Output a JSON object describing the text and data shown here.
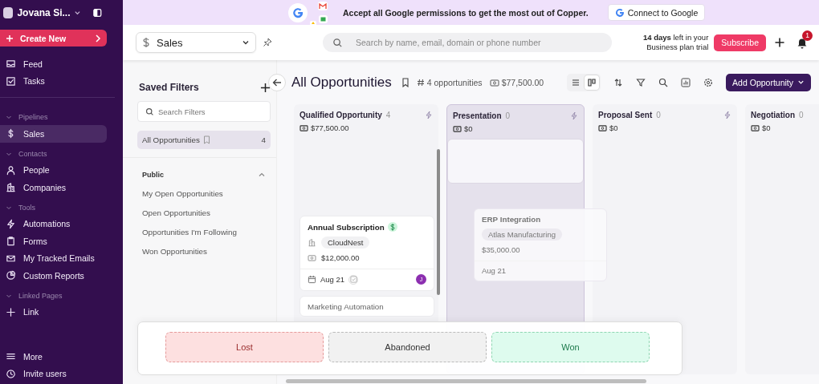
{
  "sidebar": {
    "workspace": "Jovana Si...",
    "create_button": "Create New",
    "groups": [
      {
        "items": [
          {
            "label": "Feed",
            "selected": false
          },
          {
            "label": "Tasks",
            "selected": false
          }
        ]
      },
      {
        "heading": "Pipelines",
        "items": [
          {
            "label": "Sales",
            "selected": true
          }
        ]
      },
      {
        "heading": "Contacts",
        "items": [
          {
            "label": "People",
            "selected": false
          },
          {
            "label": "Companies",
            "selected": false
          }
        ]
      },
      {
        "heading": "Tools",
        "items": [
          {
            "label": "Automations",
            "selected": false
          },
          {
            "label": "Forms",
            "selected": false
          },
          {
            "label": "My Tracked Emails",
            "selected": false
          },
          {
            "label": "Custom Reports",
            "selected": false
          }
        ]
      },
      {
        "heading": "Linked Pages",
        "items": [
          {
            "label": "Link",
            "selected": false
          }
        ]
      }
    ],
    "footer_items": [
      {
        "label": "More",
        "selected": false
      },
      {
        "label": "Invite users",
        "selected": false
      }
    ]
  },
  "banner": {
    "text": "Accept all Google permissions to get the most out of Copper.",
    "button": "Connect to Google"
  },
  "header": {
    "pipeline": "Sales",
    "search_placeholder": "Search by name, email, domain or phone number",
    "trial_bold": "14 days",
    "trial_rest": "left in your",
    "trial_line2": "Business plan trial",
    "subscribe": "Subscribe",
    "notifications": "1"
  },
  "filters": {
    "title": "Saved Filters",
    "search_placeholder": "Search Filters",
    "items": [
      {
        "label": "All Opportunities",
        "count": "4",
        "selected": true
      }
    ],
    "group": {
      "label": "Public",
      "expanded": true,
      "children": [
        "My Open Opportunities",
        "Open Opportunities",
        "Opportunities I'm Following",
        "Won Opportunities"
      ]
    }
  },
  "toolbar": {
    "title": "All Opportunities",
    "count": "4 opportunities",
    "total": "$77,500.00",
    "views": [
      {
        "kind": "list",
        "selected": false
      },
      {
        "kind": "board",
        "selected": true
      }
    ],
    "add_button": "Add Opportunity"
  },
  "columns": [
    {
      "name": "Qualified Opportunity",
      "count": "4",
      "total": "$77,500.00",
      "drop_target": false,
      "cards": [
        {
          "title": "Annual Subscription",
          "company": "CloudNest",
          "amount": "$12,000.00",
          "date": "Aug 21",
          "owner": "J"
        },
        {
          "title": "Marketing Automation"
        }
      ]
    },
    {
      "name": "Presentation",
      "count": "0",
      "total": "$0",
      "drop_target": true
    },
    {
      "name": "Proposal Sent",
      "count": "0",
      "total": "$0",
      "drop_target": false
    },
    {
      "name": "Negotiation",
      "count": "0",
      "total": "$0",
      "drop_target": false
    }
  ],
  "dragged_card": {
    "title": "ERP Integration",
    "company": "Atlas Manufacturing",
    "amount": "$35,000.00",
    "date": "Aug 21"
  },
  "drop_zones": [
    {
      "kind": "lost",
      "label": "Lost"
    },
    {
      "kind": "abandoned",
      "label": "Abandoned"
    },
    {
      "kind": "won",
      "label": "Won"
    }
  ]
}
